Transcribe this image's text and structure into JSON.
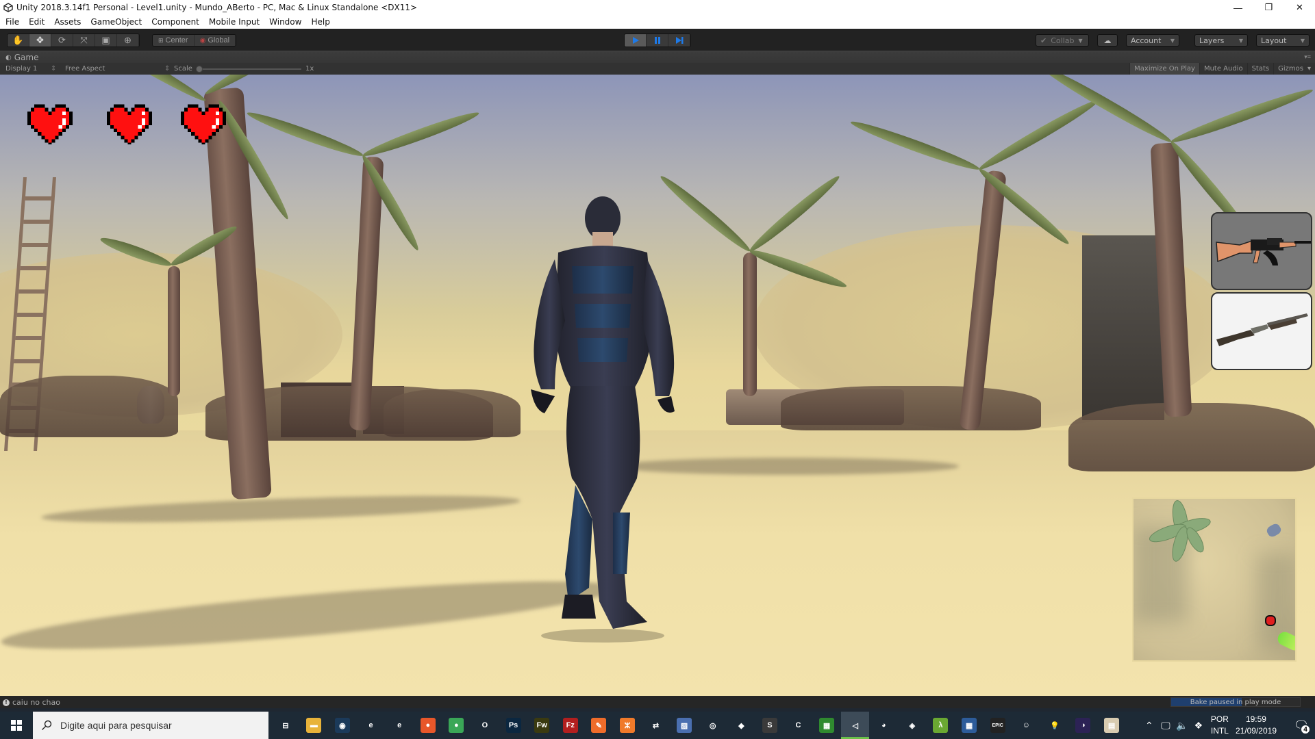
{
  "window": {
    "title": "Unity 2018.3.14f1 Personal - Level1.unity - Mundo_ABerto - PC, Mac & Linux Standalone <DX11>",
    "controls": {
      "minimize": "—",
      "restore": "❐",
      "close": "✕"
    }
  },
  "menu": [
    "File",
    "Edit",
    "Assets",
    "GameObject",
    "Component",
    "Mobile Input",
    "Window",
    "Help"
  ],
  "toolbar": {
    "transform_tools": [
      "hand-tool",
      "move-tool",
      "rotate-tool",
      "scale-tool",
      "rect-tool",
      "transform-tool"
    ],
    "active_tool": "move-tool",
    "pivot_label": "Center",
    "rotation_label": "Global",
    "play_state": "playing",
    "collab_label": "Collab",
    "account_label": "Account",
    "layers_label": "Layers",
    "layout_label": "Layout",
    "accent_color": "#1e7ae8"
  },
  "game_view": {
    "tab_label": "Game",
    "display_label": "Display 1",
    "aspect_label": "Free Aspect",
    "scale_label": "Scale",
    "scale_value": "1x",
    "maximize_on_play": "Maximize On Play",
    "mute_audio": "Mute Audio",
    "stats": "Stats",
    "gizmos": "Gizmos"
  },
  "hud": {
    "hearts": 3,
    "heart_color": "#ff1010",
    "weapons": [
      {
        "name": "AK-47 assault rifle",
        "selected": true
      },
      {
        "name": "Pump shotgun",
        "selected": false
      }
    ],
    "minimap_label": "minimap"
  },
  "status": {
    "message": "caiu no chao",
    "bake_text": "Bake paused in play mode",
    "bake_progress": 0.55
  },
  "taskbar": {
    "search_placeholder": "Digite aqui para pesquisar",
    "apps": [
      {
        "name": "task-view",
        "glyph": "⊟",
        "bg": "transparent"
      },
      {
        "name": "file-explorer",
        "glyph": "▬",
        "bg": "#e8b33a"
      },
      {
        "name": "steam",
        "glyph": "◉",
        "bg": "#1b3a5a"
      },
      {
        "name": "internet-explorer",
        "glyph": "e",
        "bg": "transparent"
      },
      {
        "name": "edge",
        "glyph": "e",
        "bg": "transparent"
      },
      {
        "name": "firefox",
        "glyph": "●",
        "bg": "#e8572a"
      },
      {
        "name": "chrome",
        "glyph": "●",
        "bg": "#3aa757"
      },
      {
        "name": "opera",
        "glyph": "O",
        "bg": "transparent"
      },
      {
        "name": "photoshop",
        "glyph": "Ps",
        "bg": "#0b2740"
      },
      {
        "name": "fireworks",
        "glyph": "Fw",
        "bg": "#3a3a10"
      },
      {
        "name": "filezilla",
        "glyph": "Fz",
        "bg": "#b21f1f"
      },
      {
        "name": "postman",
        "glyph": "✎",
        "bg": "#ef6c2a"
      },
      {
        "name": "xampp",
        "glyph": "ⵣ",
        "bg": "#f07a2a"
      },
      {
        "name": "network-tool",
        "glyph": "⇄",
        "bg": "transparent"
      },
      {
        "name": "paint-tool",
        "glyph": "▨",
        "bg": "#4a6fb0"
      },
      {
        "name": "vr-headset",
        "glyph": "◎",
        "bg": "transparent"
      },
      {
        "name": "gamemaker",
        "glyph": "◆",
        "bg": "transparent"
      },
      {
        "name": "sublime-text",
        "glyph": "S",
        "bg": "#3a3a3a"
      },
      {
        "name": "ccleaner",
        "glyph": "C",
        "bg": "transparent"
      },
      {
        "name": "app-grid",
        "glyph": "▦",
        "bg": "#2f8a2f"
      },
      {
        "name": "unity",
        "glyph": "◁",
        "bg": "transparent",
        "active": true
      },
      {
        "name": "blender",
        "glyph": "◕",
        "bg": "transparent"
      },
      {
        "name": "dev-tool",
        "glyph": "◈",
        "bg": "transparent"
      },
      {
        "name": "lambda-app",
        "glyph": "λ",
        "bg": "#6aa832"
      },
      {
        "name": "tiled-editor",
        "glyph": "▦",
        "bg": "#2d5c9a"
      },
      {
        "name": "epic-games",
        "glyph": "EPIC",
        "bg": "#222"
      },
      {
        "name": "godot",
        "glyph": "☺",
        "bg": "transparent"
      },
      {
        "name": "lightbulb-app",
        "glyph": "💡",
        "bg": "transparent"
      },
      {
        "name": "eclipse",
        "glyph": "◑",
        "bg": "#2c2255"
      },
      {
        "name": "misc-app",
        "glyph": "▤",
        "bg": "#d8cbb0"
      }
    ],
    "tray": {
      "language": "POR",
      "layout": "INTL",
      "time": "19:59",
      "date": "21/09/2019",
      "notifications": "4"
    }
  }
}
